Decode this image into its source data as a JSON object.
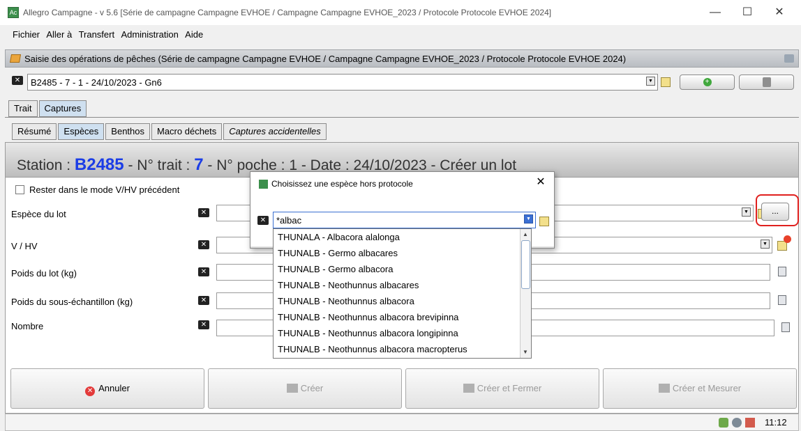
{
  "window": {
    "title": "Allegro Campagne - v 5.6 [Série de campagne Campagne EVHOE / Campagne Campagne EVHOE_2023 / Protocole Protocole EVHOE 2024]",
    "app_icon_text": "Ac",
    "controls": {
      "minimize": "—",
      "maximize": "☐",
      "close": "✕"
    }
  },
  "menu": [
    "Fichier",
    "Aller à",
    "Transfert",
    "Administration",
    "Aide"
  ],
  "frame": {
    "title": "Saisie des opérations de pêches (Série de campagne Campagne EVHOE / Campagne Campagne EVHOE_2023 / Protocole Protocole EVHOE 2024)"
  },
  "operation": {
    "selected": "B2485 - 7 - 1 - 24/10/2023 - Gn6",
    "add_icon": "plus-icon",
    "delete_icon": "trash-icon"
  },
  "tabs_main": [
    {
      "label": "Trait",
      "selected": false
    },
    {
      "label": "Captures",
      "selected": true
    }
  ],
  "tabs_sub": [
    {
      "label": "Résumé",
      "selected": false
    },
    {
      "label": "Espèces",
      "selected": true
    },
    {
      "label": "Benthos",
      "selected": false
    },
    {
      "label": "Macro déchets",
      "selected": false
    },
    {
      "label": "Captures accidentelles",
      "selected": false
    }
  ],
  "station": {
    "prefix": "Station : ",
    "code": "B2485",
    "trait_label": " - N° trait : ",
    "trait": "7",
    "rest": " - N° poche : 1 - Date : 24/10/2023 - Créer un lot"
  },
  "form": {
    "keep_mode_label": "Rester dans le mode V/HV précédent",
    "fields": [
      {
        "label": "Espèce du lot"
      },
      {
        "label": "V / HV"
      },
      {
        "label": "Poids du lot (kg)"
      },
      {
        "label": "Poids du sous-échantillon (kg)"
      },
      {
        "label": "Nombre"
      }
    ],
    "select_button": "..."
  },
  "actions": {
    "cancel": "Annuler",
    "create": "Créer",
    "create_close": "Créer et Fermer",
    "create_measure": "Créer et Mesurer"
  },
  "status": {
    "time": "11:12"
  },
  "dialog": {
    "title": "Choisissez une espèce hors protocole",
    "close": "✕",
    "input_value": "*albac",
    "options": [
      "THUNALA - Albacora alalonga",
      "THUNALB - Germo albacares",
      "THUNALB - Germo albacora",
      "THUNALB - Neothunnus albacares",
      "THUNALB - Neothunnus albacora",
      "THUNALB - Neothunnus albacora brevipinna",
      "THUNALB - Neothunnus albacora longipinna",
      "THUNALB - Neothunnus albacora macropterus"
    ]
  },
  "colors": {
    "station_highlight": "#1b3de6",
    "annotation_box": "#e0201e"
  }
}
